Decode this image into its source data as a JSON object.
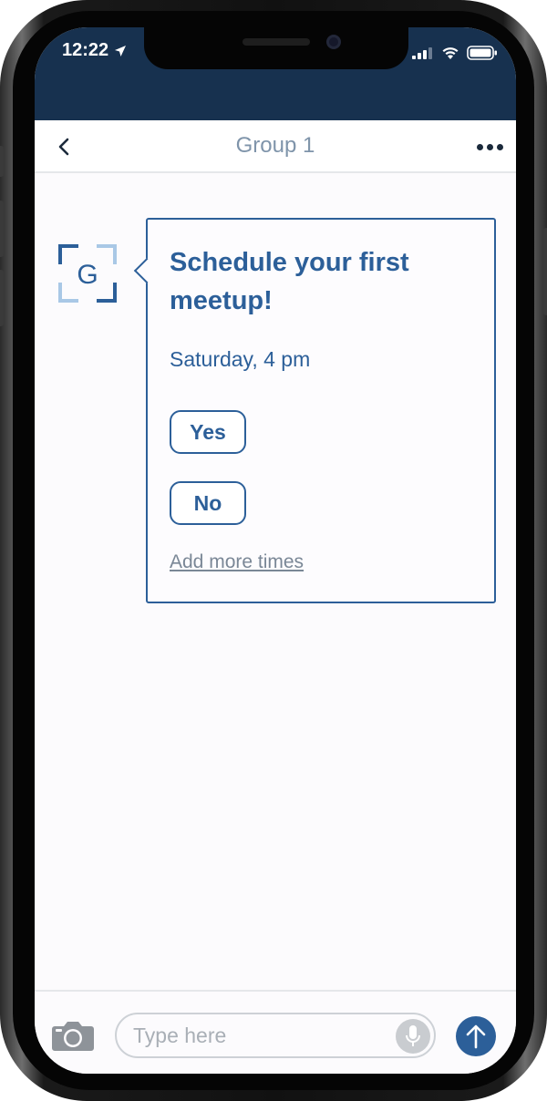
{
  "status_bar": {
    "time": "12:22",
    "location_icon": "location-arrow-icon",
    "signal_icon": "cellular-signal-icon",
    "wifi_icon": "wifi-icon",
    "battery_icon": "battery-icon"
  },
  "navbar": {
    "title": "Group 1",
    "back_icon": "chevron-left-icon",
    "more_icon": "more-dots-icon"
  },
  "message": {
    "avatar_letter": "G",
    "title": "Schedule your first meetup!",
    "time": "Saturday, 4 pm",
    "options": [
      "Yes",
      "No"
    ],
    "add_more_label": "Add more times"
  },
  "composer": {
    "placeholder": "Type here",
    "camera_icon": "camera-icon",
    "mic_icon": "microphone-icon",
    "send_icon": "arrow-up-icon"
  },
  "colors": {
    "header_bg": "#17314f",
    "accent": "#2c5f99",
    "nav_title": "#7f94aa",
    "link_gray": "#7a8796"
  }
}
